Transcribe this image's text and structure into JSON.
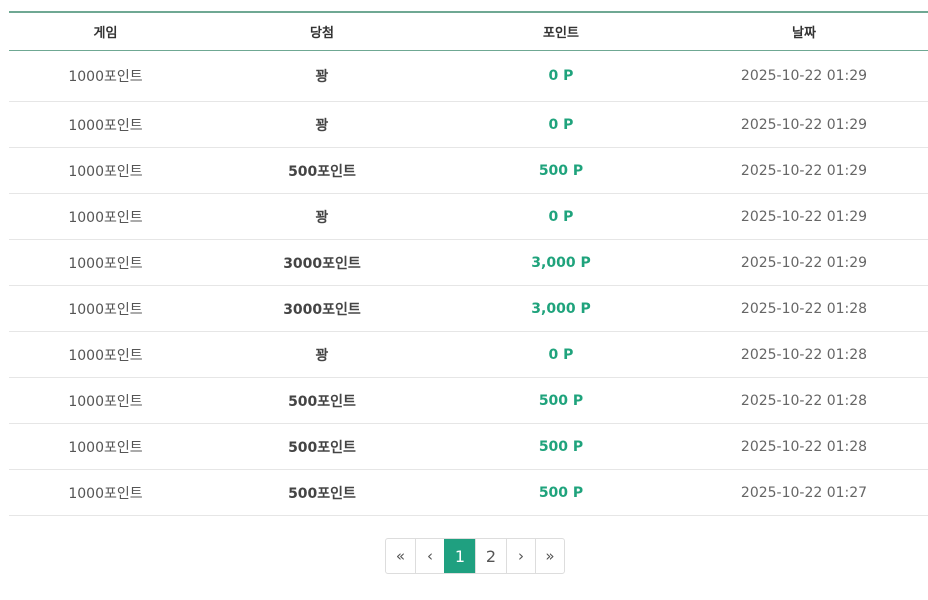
{
  "table": {
    "headers": [
      "게임",
      "당첨",
      "포인트",
      "날짜"
    ],
    "rows": [
      {
        "game": "1000포인트",
        "prize": "꽝",
        "points": "0 P",
        "date": "2025-10-22 01:29"
      },
      {
        "game": "1000포인트",
        "prize": "꽝",
        "points": "0 P",
        "date": "2025-10-22 01:29"
      },
      {
        "game": "1000포인트",
        "prize": "500포인트",
        "points": "500 P",
        "date": "2025-10-22 01:29"
      },
      {
        "game": "1000포인트",
        "prize": "꽝",
        "points": "0 P",
        "date": "2025-10-22 01:29"
      },
      {
        "game": "1000포인트",
        "prize": "3000포인트",
        "points": "3,000 P",
        "date": "2025-10-22 01:29"
      },
      {
        "game": "1000포인트",
        "prize": "3000포인트",
        "points": "3,000 P",
        "date": "2025-10-22 01:28"
      },
      {
        "game": "1000포인트",
        "prize": "꽝",
        "points": "0 P",
        "date": "2025-10-22 01:28"
      },
      {
        "game": "1000포인트",
        "prize": "500포인트",
        "points": "500 P",
        "date": "2025-10-22 01:28"
      },
      {
        "game": "1000포인트",
        "prize": "500포인트",
        "points": "500 P",
        "date": "2025-10-22 01:28"
      },
      {
        "game": "1000포인트",
        "prize": "500포인트",
        "points": "500 P",
        "date": "2025-10-22 01:27"
      }
    ]
  },
  "pagination": {
    "first": "«",
    "prev": "‹",
    "pages": [
      "1",
      "2"
    ],
    "current": "1",
    "next": "›",
    "last": "»"
  },
  "colors": {
    "accent": "#1fa080",
    "points_text": "#1fa37c",
    "header_rule": "#6fa893"
  }
}
